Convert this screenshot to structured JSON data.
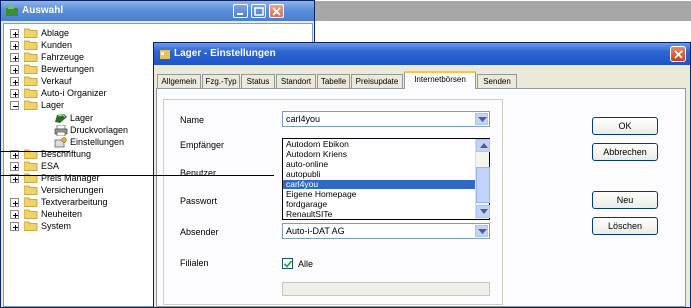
{
  "back_window": {
    "title": "Auswahl",
    "tree": [
      {
        "label": "Ablage",
        "level": 0,
        "expander": "plus"
      },
      {
        "label": "Kunden",
        "level": 0,
        "expander": "plus"
      },
      {
        "label": "Fahrzeuge",
        "level": 0,
        "expander": "plus"
      },
      {
        "label": "Bewertungen",
        "level": 0,
        "expander": "plus"
      },
      {
        "label": "Verkauf",
        "level": 0,
        "expander": "plus"
      },
      {
        "label": "Auto-i Organizer",
        "level": 0,
        "expander": "plus"
      },
      {
        "label": "Lager",
        "level": 0,
        "expander": "minus"
      },
      {
        "label": "Lager",
        "level": 1,
        "icon": "car"
      },
      {
        "label": "Druckvorlagen",
        "level": 1,
        "icon": "printer"
      },
      {
        "label": "Einstellungen",
        "level": 1,
        "icon": "settings"
      },
      {
        "label": "Beschriftung",
        "level": 0,
        "expander": "plus"
      },
      {
        "label": "ESA",
        "level": 0,
        "expander": "plus"
      },
      {
        "label": "Preis Manager",
        "level": 0,
        "expander": "plus"
      },
      {
        "label": "Versicherungen",
        "level": 0,
        "expander": "none"
      },
      {
        "label": "Textverarbeitung",
        "level": 0,
        "expander": "plus"
      },
      {
        "label": "Neuheiten",
        "level": 0,
        "expander": "plus"
      },
      {
        "label": "System",
        "level": 0,
        "expander": "plus"
      }
    ]
  },
  "dialog": {
    "title": "Lager - Einstellungen",
    "tabs": [
      {
        "label": "Allgemein",
        "active": false
      },
      {
        "label": "Fzg.-Typ",
        "active": false
      },
      {
        "label": "Status",
        "active": false
      },
      {
        "label": "Standort",
        "active": false
      },
      {
        "label": "Tabelle",
        "active": false
      },
      {
        "label": "Preisupdate",
        "active": false
      },
      {
        "label": "Internetbörsen",
        "active": true
      },
      {
        "label": "Senden",
        "active": false
      }
    ],
    "fields": {
      "name_label": "Name",
      "name_value": "carl4you",
      "empfaenger_label": "Empfänger",
      "benutzer_label": "Benutzer",
      "passwort_label": "Passwort",
      "absender_label": "Absender",
      "absender_value": "Auto-i-DAT AG",
      "filialen_label": "Filialen",
      "alle_label": "Alle",
      "alle_checked": true
    },
    "dropdown": {
      "items": [
        "Autodorn Ebikon",
        "Autodorn Kriens",
        "auto-online",
        "autopubli",
        "carl4you",
        "Eigene Homepage",
        "fordgarage",
        "RenaultSITe"
      ],
      "selected": "carl4you"
    },
    "buttons": {
      "ok": "OK",
      "abbrechen": "Abbrechen",
      "neu": "Neu",
      "loeschen": "Löschen"
    }
  },
  "colors": {
    "titlebar_active": "#1d55c8",
    "selection": "#316ac5",
    "dialog_bg": "#ece9d8",
    "close_red": "#c8401f",
    "tab_highlight": "#ffc83c"
  },
  "icons": [
    "app-icon",
    "folder-icon",
    "car-icon",
    "printer-icon",
    "settings-icon",
    "minimize-icon",
    "maximize-icon",
    "close-icon",
    "chevron-down-icon",
    "scroll-up-icon",
    "scroll-down-icon",
    "check-icon"
  ]
}
